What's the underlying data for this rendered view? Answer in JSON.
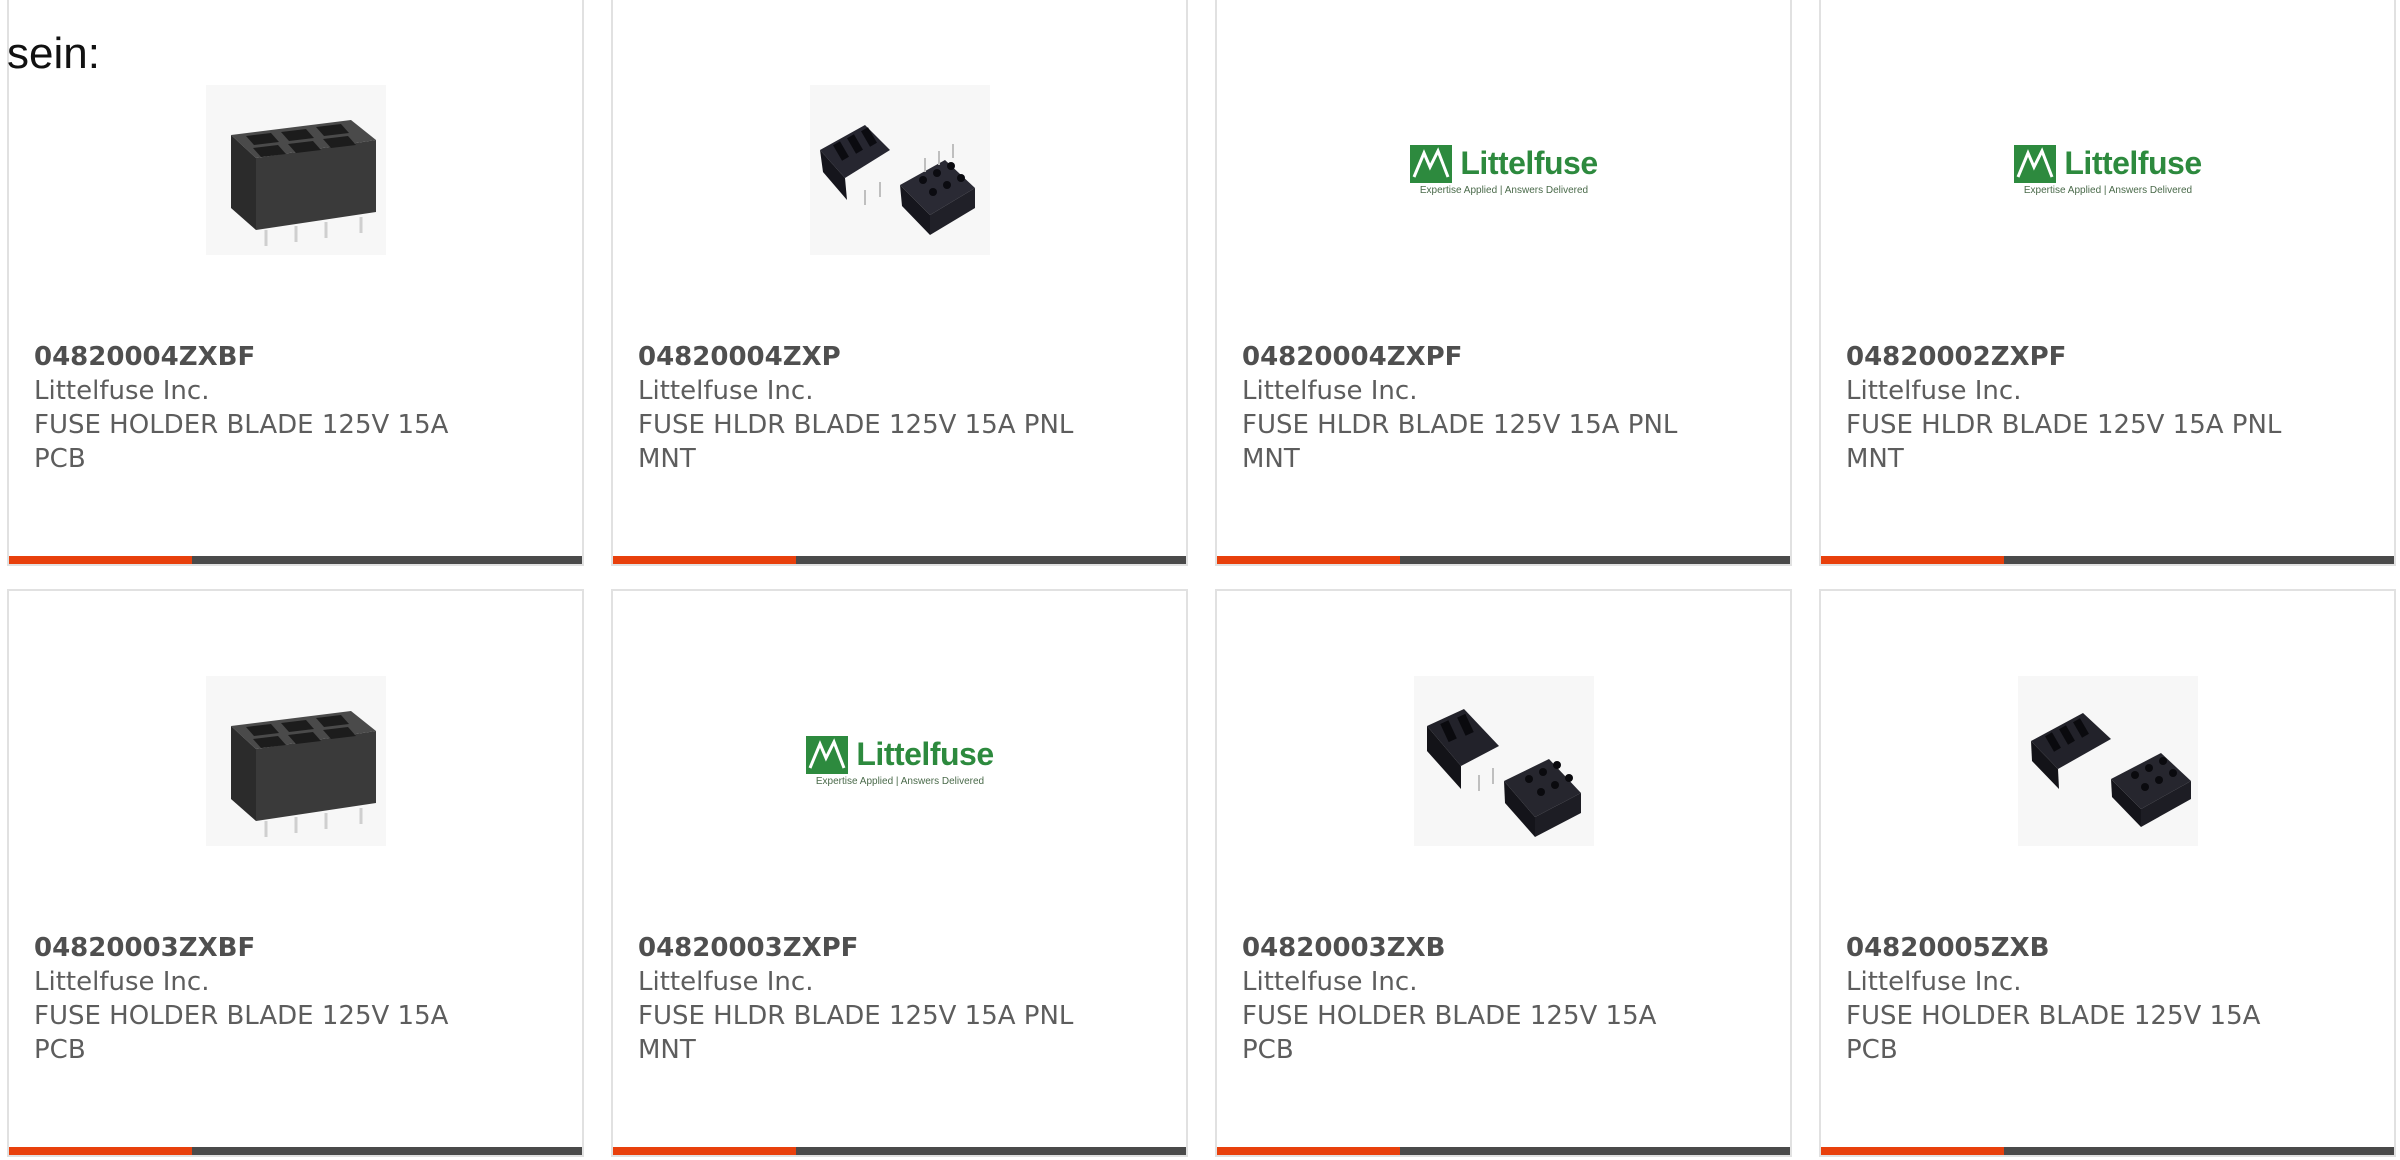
{
  "intro_text": "sein:",
  "colors": {
    "accent": "#e8400c",
    "bar": "#4a4a4a",
    "logo_green": "#2d8a3e",
    "text": "#5d5d5d"
  },
  "logo": {
    "word": "Littelfuse",
    "tagline": "Expertise Applied | Answers Delivered"
  },
  "products": [
    {
      "part": "04820004ZXBF",
      "manufacturer": "Littelfuse Inc.",
      "description": "FUSE HOLDER BLADE 125V 15A PCB",
      "image": "fuse-holder-pcb-image"
    },
    {
      "part": "04820004ZXP",
      "manufacturer": "Littelfuse Inc.",
      "description": "FUSE HLDR BLADE 125V 15A PNL MNT",
      "image": "fuse-holder-pair-image"
    },
    {
      "part": "04820004ZXPF",
      "manufacturer": "Littelfuse Inc.",
      "description": "FUSE HLDR BLADE 125V 15A PNL MNT",
      "image": "littelfuse-logo"
    },
    {
      "part": "04820002ZXPF",
      "manufacturer": "Littelfuse Inc.",
      "description": "FUSE HLDR BLADE 125V 15A PNL MNT",
      "image": "littelfuse-logo"
    },
    {
      "part": "04820003ZXBF",
      "manufacturer": "Littelfuse Inc.",
      "description": "FUSE HOLDER BLADE 125V 15A PCB",
      "image": "fuse-holder-pcb-image"
    },
    {
      "part": "04820003ZXPF",
      "manufacturer": "Littelfuse Inc.",
      "description": "FUSE HLDR BLADE 125V 15A PNL MNT",
      "image": "littelfuse-logo"
    },
    {
      "part": "04820003ZXB",
      "manufacturer": "Littelfuse Inc.",
      "description": "FUSE HOLDER BLADE 125V 15A PCB",
      "image": "fuse-holder-pair-image"
    },
    {
      "part": "04820005ZXB",
      "manufacturer": "Littelfuse Inc.",
      "description": "FUSE HOLDER BLADE 125V 15A PCB",
      "image": "fuse-holder-pair-image"
    }
  ]
}
